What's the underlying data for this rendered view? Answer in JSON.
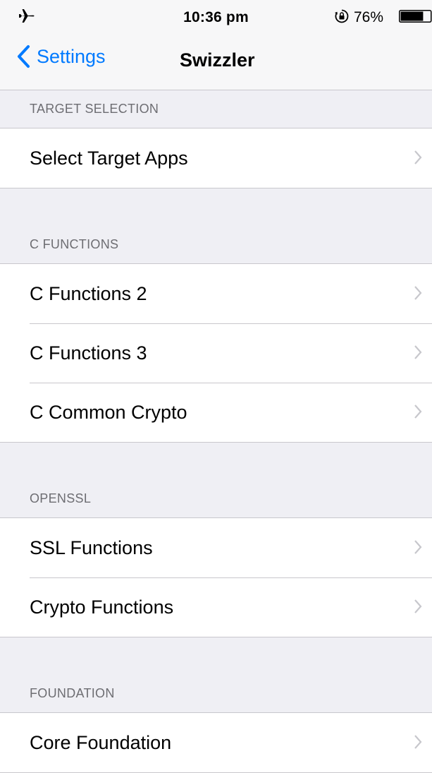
{
  "status_bar": {
    "time": "10:36 pm",
    "battery_percent": "76%",
    "battery_level": 0.76,
    "icons": [
      "airplane-icon",
      "orientation-lock-icon",
      "battery-icon"
    ]
  },
  "nav_bar": {
    "back_label": "Settings",
    "title": "Swizzler",
    "accent_color": "#007aff"
  },
  "sections": [
    {
      "header": "TARGET SELECTION",
      "rows": [
        {
          "label": "Select Target Apps"
        }
      ]
    },
    {
      "header": "C FUNCTIONS",
      "rows": [
        {
          "label": "C Functions 2"
        },
        {
          "label": "C Functions 3"
        },
        {
          "label": "C Common Crypto"
        }
      ]
    },
    {
      "header": "OPENSSL",
      "rows": [
        {
          "label": "SSL Functions"
        },
        {
          "label": "Crypto Functions"
        }
      ]
    },
    {
      "header": "FOUNDATION",
      "rows": [
        {
          "label": "Core Foundation"
        }
      ]
    }
  ]
}
